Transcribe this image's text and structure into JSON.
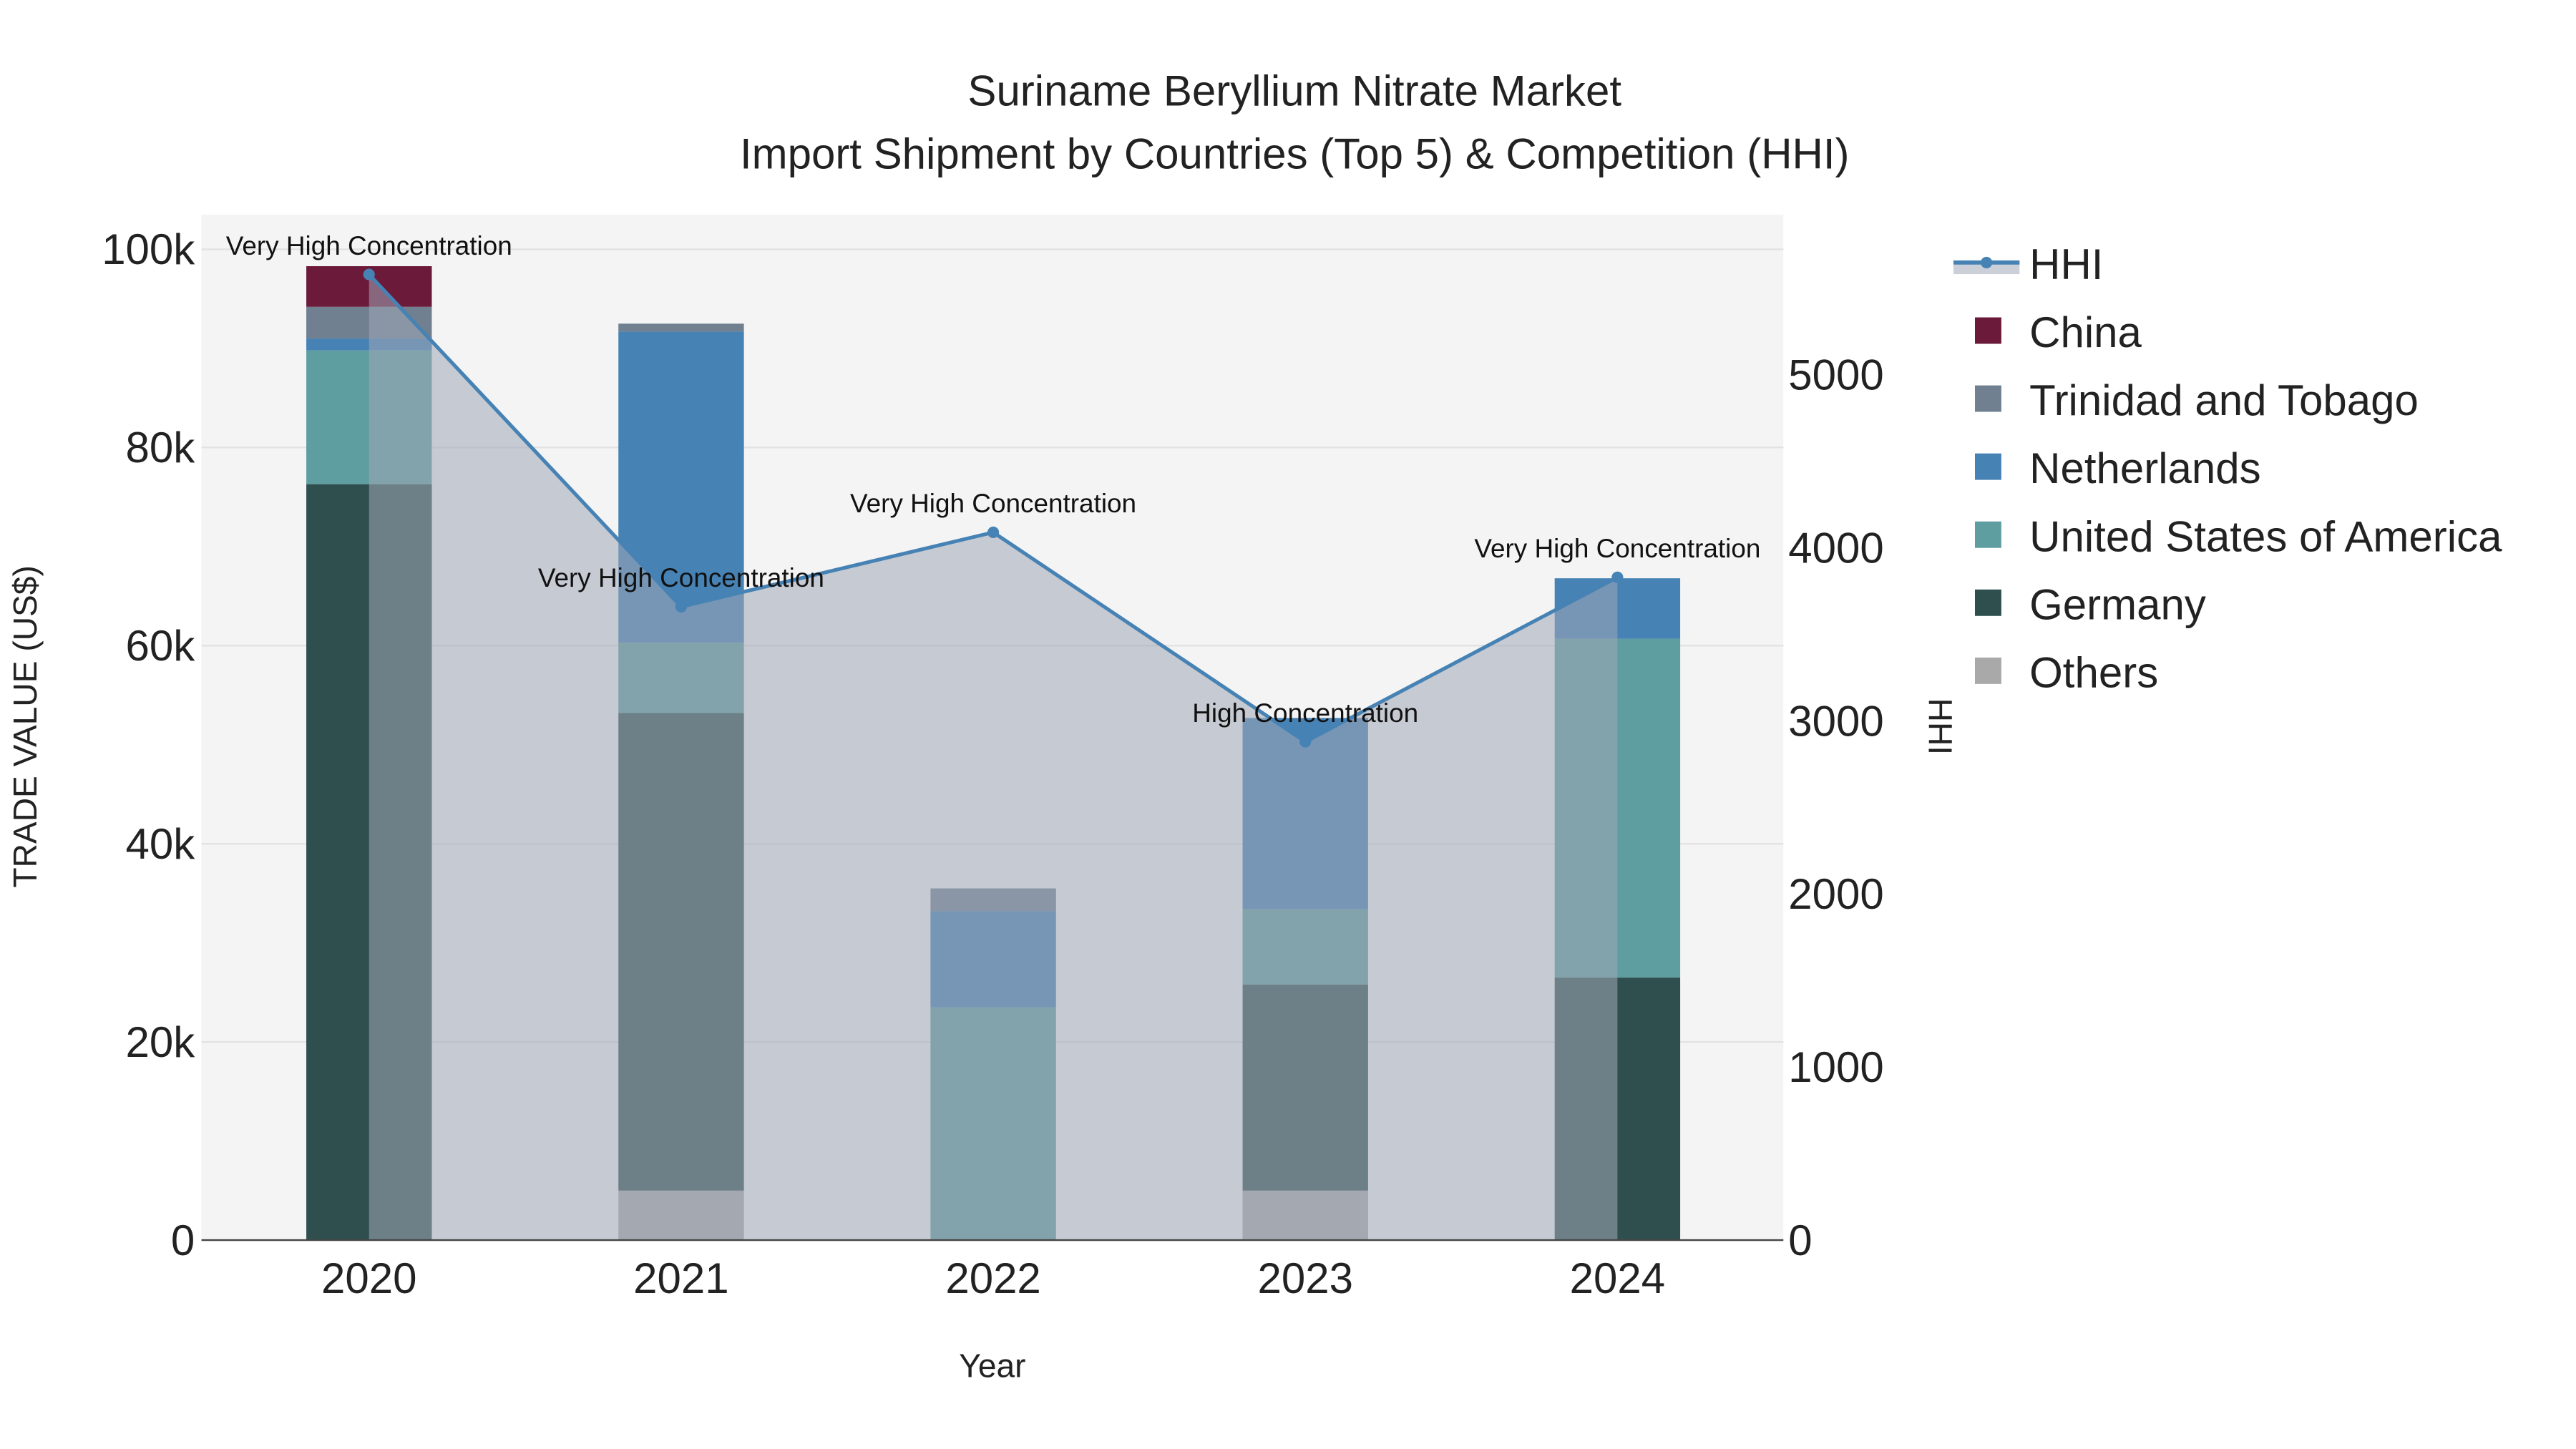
{
  "chart_data": {
    "type": "bar",
    "barmode": "stack",
    "title": "Suriname Beryllium Nitrate Market",
    "subtitle": "Import Shipment by Countries (Top 5) & Competition (HHI)",
    "xlabel": "Year",
    "ylabel": "TRADE VALUE (US$)",
    "y2label": "HHI",
    "categories": [
      "2020",
      "2021",
      "2022",
      "2023",
      "2024"
    ],
    "ylim": [
      0,
      103000
    ],
    "y2lim": [
      0,
      5900
    ],
    "yticks": [
      {
        "v": 0,
        "label": "0"
      },
      {
        "v": 20000,
        "label": "20k"
      },
      {
        "v": 40000,
        "label": "40k"
      },
      {
        "v": 60000,
        "label": "60k"
      },
      {
        "v": 80000,
        "label": "80k"
      },
      {
        "v": 100000,
        "label": "100k"
      }
    ],
    "y2ticks": [
      {
        "v": 0,
        "label": "0"
      },
      {
        "v": 1000,
        "label": "1000"
      },
      {
        "v": 2000,
        "label": "2000"
      },
      {
        "v": 3000,
        "label": "3000"
      },
      {
        "v": 4000,
        "label": "4000"
      },
      {
        "v": 5000,
        "label": "5000"
      }
    ],
    "series": [
      {
        "name": "Others",
        "color": "#a9a9a9",
        "values": [
          0,
          5000,
          0,
          5000,
          0
        ]
      },
      {
        "name": "Germany",
        "color": "#2f4f4f",
        "values": [
          76300,
          48200,
          0,
          20800,
          26500
        ]
      },
      {
        "name": "United States of America",
        "color": "#5f9ea0",
        "values": [
          13500,
          7100,
          23500,
          7600,
          34200
        ]
      },
      {
        "name": "Netherlands",
        "color": "#4682b4",
        "values": [
          1200,
          31400,
          9700,
          19300,
          6100
        ]
      },
      {
        "name": "Trinidad and Tobago",
        "color": "#708090",
        "values": [
          3200,
          800,
          2300,
          0,
          0
        ]
      },
      {
        "name": "China",
        "color": "#6b1a3a",
        "values": [
          4100,
          0,
          0,
          0,
          0
        ]
      }
    ],
    "hhi": {
      "name": "HHI",
      "color": "#4682b4",
      "values": [
        5580,
        3660,
        4090,
        2880,
        3830
      ],
      "annotations": [
        "Very High Concentration",
        "Very High Concentration",
        "Very High Concentration",
        "High Concentration",
        "Very High Concentration"
      ]
    },
    "legend_order": [
      "HHI",
      "China",
      "Trinidad and Tobago",
      "Netherlands",
      "United States of America",
      "Germany",
      "Others"
    ],
    "legend_position": "right",
    "grid": true
  }
}
